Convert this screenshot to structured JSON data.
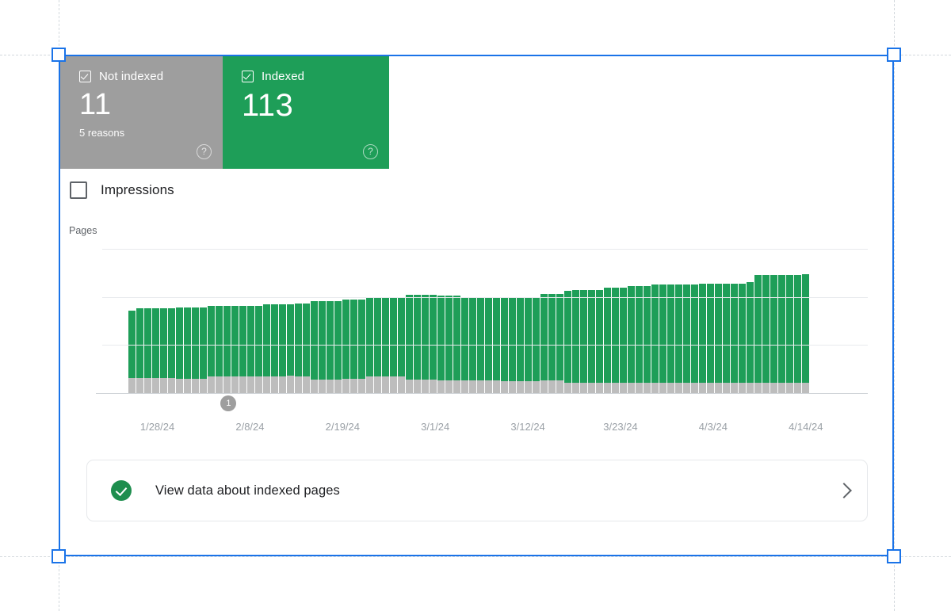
{
  "cards": [
    {
      "id": "not-indexed",
      "label": "Not indexed",
      "value": "11",
      "sub": "5 reasons",
      "help": "?",
      "color": "#9e9e9e",
      "checked": true
    },
    {
      "id": "indexed",
      "label": "Indexed",
      "value": "113",
      "sub": "",
      "help": "?",
      "color": "#1e9e58",
      "checked": true
    }
  ],
  "impressions": {
    "label": "Impressions",
    "checked": false
  },
  "cta": {
    "label": "View data about indexed pages",
    "icon": "check-circle-icon",
    "chevron": "chevron-right-icon"
  },
  "annotation": {
    "marker": "1",
    "x_ratio": 0.165
  },
  "chart_data": {
    "type": "bar",
    "stacked": true,
    "title": "",
    "ylabel": "Pages",
    "xlabel": "",
    "ylim": [
      0,
      150
    ],
    "yticks": [
      150,
      100,
      50,
      0
    ],
    "grid": true,
    "legend_position": "cards-above",
    "xtick_labels": [
      "1/28/24",
      "2/8/24",
      "2/19/24",
      "3/1/24",
      "3/12/24",
      "3/23/24",
      "4/3/24",
      "4/14/24"
    ],
    "xtick_positions": [
      0.072,
      0.193,
      0.314,
      0.435,
      0.556,
      0.677,
      0.798,
      0.919
    ],
    "series": [
      {
        "name": "Indexed",
        "color": "#1e9e58",
        "values": [
          70,
          72,
          72,
          72,
          72,
          72,
          74,
          74,
          74,
          74,
          74,
          74,
          74,
          74,
          74,
          74,
          74,
          75,
          75,
          75,
          74,
          76,
          76,
          82,
          82,
          82,
          82,
          82,
          82,
          82,
          82,
          83,
          83,
          83,
          83,
          88,
          88,
          88,
          88,
          88,
          88,
          88,
          87,
          87,
          87,
          87,
          87,
          88,
          88,
          88,
          88,
          88,
          90,
          90,
          90,
          95,
          96,
          96,
          96,
          96,
          99,
          99,
          99,
          100,
          100,
          100,
          102,
          102,
          102,
          102,
          102,
          102,
          103,
          103,
          103,
          103,
          103,
          103,
          104,
          112,
          112,
          112,
          112,
          112,
          112,
          113
        ]
      },
      {
        "name": "Not indexed",
        "color": "#bdbdbd",
        "values": [
          16,
          16,
          16,
          16,
          16,
          16,
          15,
          15,
          15,
          15,
          17,
          17,
          17,
          17,
          17,
          17,
          17,
          17,
          17,
          17,
          18,
          17,
          17,
          14,
          14,
          14,
          14,
          15,
          15,
          15,
          17,
          17,
          17,
          17,
          17,
          14,
          14,
          14,
          14,
          13,
          13,
          13,
          13,
          13,
          13,
          13,
          13,
          12,
          12,
          12,
          12,
          12,
          13,
          13,
          13,
          11,
          11,
          11,
          11,
          11,
          11,
          11,
          11,
          11,
          11,
          11,
          11,
          11,
          11,
          11,
          11,
          11,
          11,
          11,
          11,
          11,
          11,
          11,
          11,
          11,
          11,
          11,
          11,
          11,
          11,
          11
        ]
      }
    ],
    "totals": [
      86,
      88,
      88,
      88,
      88,
      88,
      89,
      89,
      89,
      89,
      91,
      91,
      91,
      91,
      91,
      91,
      91,
      92,
      92,
      92,
      92,
      93,
      93,
      96,
      96,
      96,
      96,
      97,
      97,
      97,
      99,
      100,
      100,
      100,
      100,
      102,
      102,
      102,
      102,
      101,
      101,
      101,
      100,
      100,
      100,
      100,
      100,
      100,
      100,
      100,
      100,
      100,
      103,
      103,
      103,
      106,
      107,
      107,
      107,
      107,
      110,
      110,
      110,
      111,
      111,
      111,
      113,
      113,
      113,
      113,
      113,
      113,
      114,
      114,
      114,
      114,
      114,
      114,
      115,
      123,
      123,
      123,
      123,
      123,
      123,
      124
    ]
  }
}
